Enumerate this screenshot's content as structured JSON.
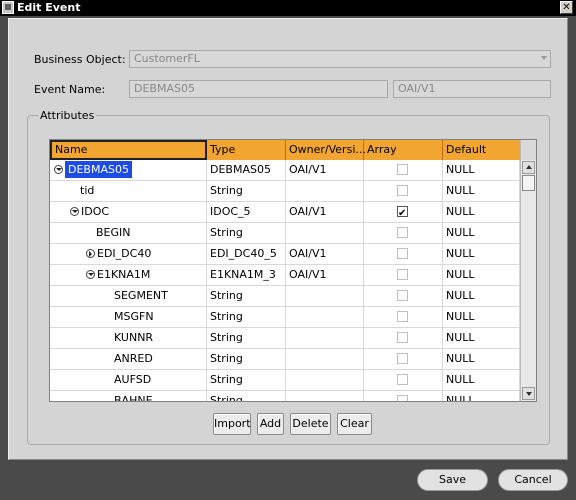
{
  "window": {
    "title": "Edit Event",
    "close_glyph": "✕"
  },
  "form": {
    "business_object_label": "Business Object:",
    "business_object_value": "CustomerFL",
    "event_name_label": "Event Name:",
    "event_name_value": "DEBMAS05",
    "owner_version_value": "OAI/V1"
  },
  "attributes": {
    "group_label": "Attributes",
    "columns": [
      "Name",
      "Type",
      "Owner/Versi...",
      "Array",
      "Default"
    ],
    "rows": [
      {
        "name": "DEBMAS05",
        "depth": 0,
        "expander": "expanded",
        "type": "DEBMAS05",
        "owner": "OAI/V1",
        "array": false,
        "default": "NULL",
        "selected": true
      },
      {
        "name": "tid",
        "depth": 1,
        "expander": "",
        "type": "String",
        "owner": "",
        "array": false,
        "default": "NULL"
      },
      {
        "name": "IDOC",
        "depth": 1,
        "expander": "expanded",
        "type": "IDOC_5",
        "owner": "OAI/V1",
        "array": true,
        "default": "NULL"
      },
      {
        "name": "BEGIN",
        "depth": 2,
        "expander": "",
        "type": "String",
        "owner": "",
        "array": false,
        "default": "NULL"
      },
      {
        "name": "EDI_DC40",
        "depth": 2,
        "expander": "collapsed",
        "type": "EDI_DC40_5",
        "owner": "OAI/V1",
        "array": false,
        "default": "NULL"
      },
      {
        "name": "E1KNA1M",
        "depth": 2,
        "expander": "expanded",
        "type": "E1KNA1M_3",
        "owner": "OAI/V1",
        "array": false,
        "default": "NULL"
      },
      {
        "name": "SEGMENT",
        "depth": 3,
        "expander": "",
        "type": "String",
        "owner": "",
        "array": false,
        "default": "NULL"
      },
      {
        "name": "MSGFN",
        "depth": 3,
        "expander": "",
        "type": "String",
        "owner": "",
        "array": false,
        "default": "NULL"
      },
      {
        "name": "KUNNR",
        "depth": 3,
        "expander": "",
        "type": "String",
        "owner": "",
        "array": false,
        "default": "NULL"
      },
      {
        "name": "ANRED",
        "depth": 3,
        "expander": "",
        "type": "String",
        "owner": "",
        "array": false,
        "default": "NULL"
      },
      {
        "name": "AUFSD",
        "depth": 3,
        "expander": "",
        "type": "String",
        "owner": "",
        "array": false,
        "default": "NULL"
      },
      {
        "name": "BAHNE",
        "depth": 3,
        "expander": "",
        "type": "String",
        "owner": "",
        "array": false,
        "default": "NULL"
      }
    ]
  },
  "buttons": {
    "import": "Import",
    "add": "Add",
    "delete": "Delete",
    "clear": "Clear"
  },
  "footer": {
    "save": "Save",
    "cancel": "Cancel"
  },
  "colors": {
    "header_bg": "#f3a531",
    "selection": "#1c4be6"
  }
}
